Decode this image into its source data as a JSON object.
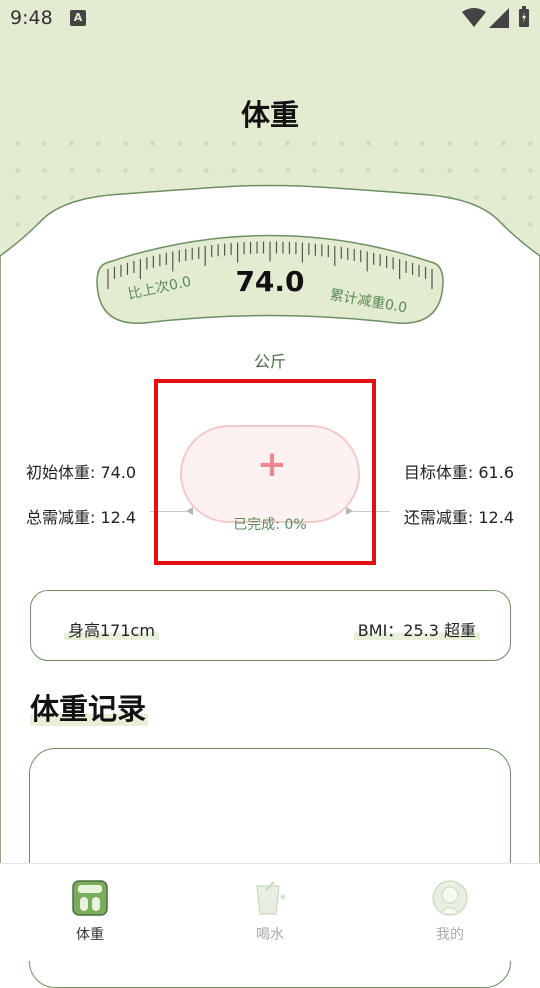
{
  "status_bar": {
    "time": "9:48",
    "notification_badge": "A"
  },
  "header": {
    "title": "体重"
  },
  "gauge": {
    "value": "74.0",
    "left_label": "比上次0.0",
    "right_label": "累计减重0.0",
    "unit": "公斤"
  },
  "stats": {
    "initial_weight": "初始体重: 74.0",
    "total_to_lose": "总需减重: 12.4",
    "target_weight": "目标体重: 61.6",
    "remaining_to_lose": "还需减重: 12.4"
  },
  "add_button": {
    "icon": "plus-icon",
    "progress_text": "已完成: 0%",
    "progress": 0
  },
  "body_info": {
    "height": "身高171cm",
    "bmi": "BMI：25.3 超重"
  },
  "records": {
    "title": "体重记录"
  },
  "bottom_nav": {
    "items": [
      {
        "label": "体重",
        "icon": "scale-icon",
        "active": true
      },
      {
        "label": "喝水",
        "icon": "water-cup-icon",
        "active": false
      },
      {
        "label": "我的",
        "icon": "profile-icon",
        "active": false
      }
    ]
  },
  "colors": {
    "header_bg": "#e3ecd1",
    "accent_green": "#5b8a59",
    "border_green": "#6d8f62",
    "add_pink": "#ee8a8f",
    "highlight_red": "#e21010"
  }
}
